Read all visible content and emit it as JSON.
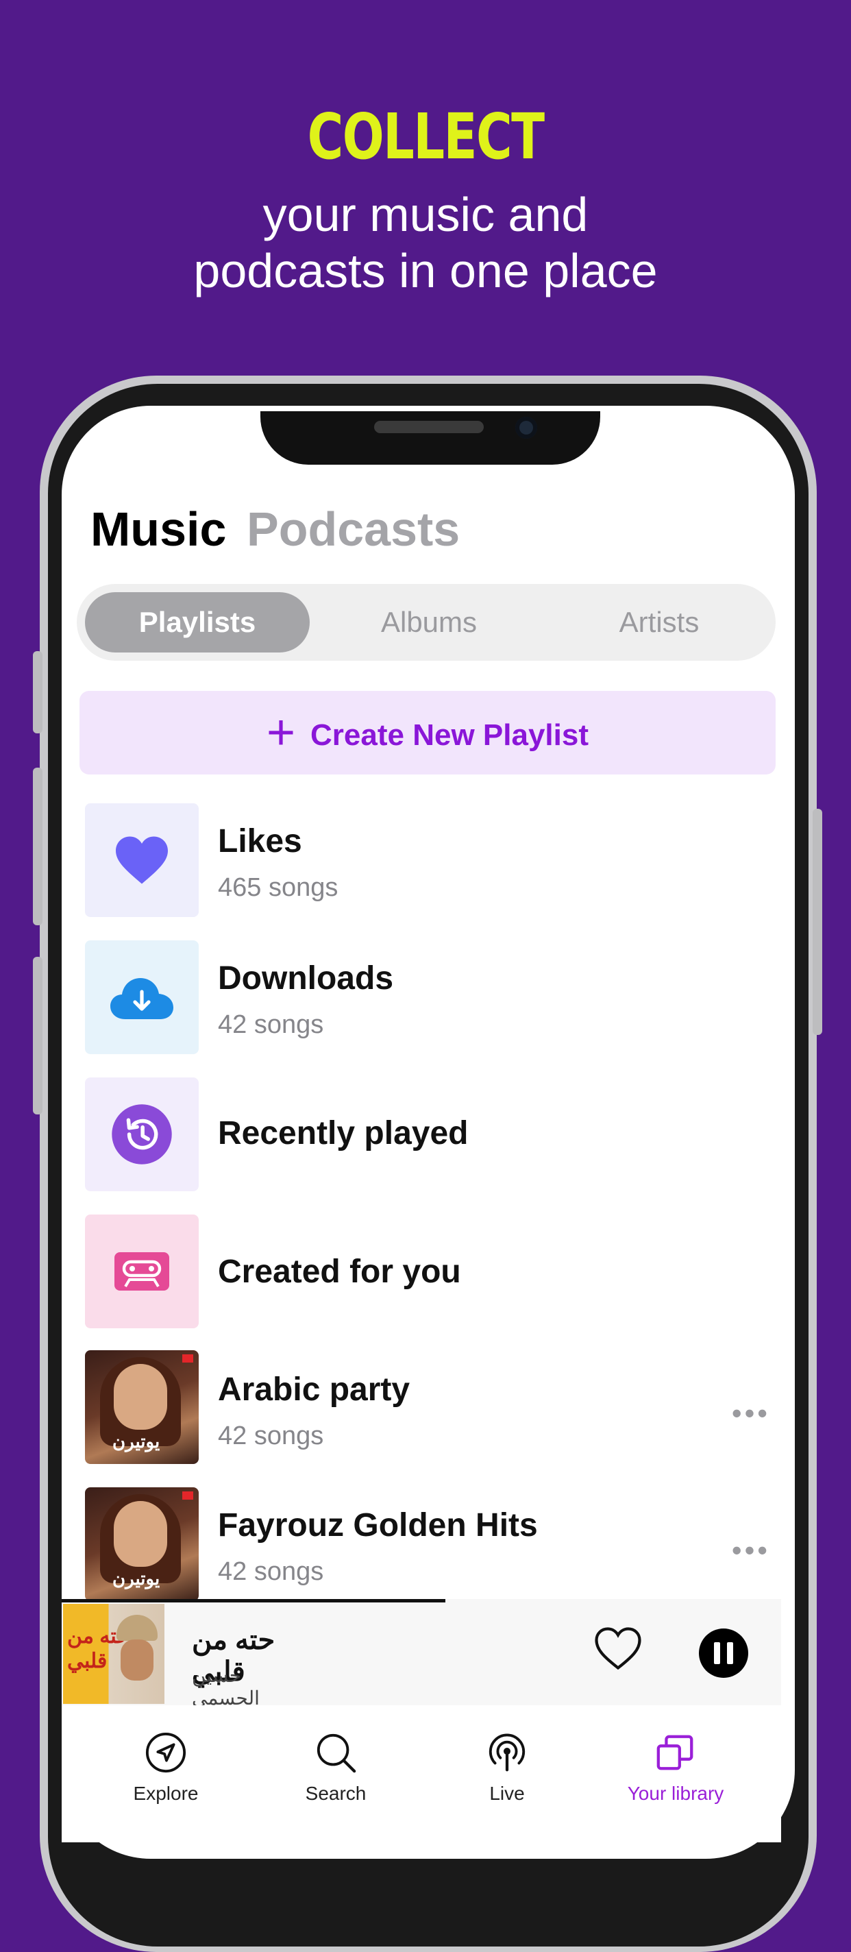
{
  "promo": {
    "headline": "COLLECT",
    "subline1": "your music and",
    "subline2": "podcasts in one place"
  },
  "colors": {
    "background": "#521a8a",
    "headline": "#dff21a",
    "accent": "#9a1fd8",
    "create_bg": "#f2e5fc"
  },
  "library": {
    "segments": {
      "music": "Music",
      "podcasts": "Podcasts"
    },
    "tabs": [
      {
        "label": "Playlists",
        "active": true
      },
      {
        "label": "Albums",
        "active": false
      },
      {
        "label": "Artists",
        "active": false
      }
    ],
    "create_label": "Create New Playlist",
    "items": [
      {
        "title": "Likes",
        "subtitle": "465 songs",
        "icon": "heart-icon"
      },
      {
        "title": "Downloads",
        "subtitle": "42 songs",
        "icon": "cloud-download-icon"
      },
      {
        "title": "Recently played",
        "subtitle": "",
        "icon": "history-icon"
      },
      {
        "title": "Created for you",
        "subtitle": "",
        "icon": "cassette-icon"
      },
      {
        "title": "Arabic party",
        "subtitle": "42 songs",
        "icon": "album-art"
      },
      {
        "title": "Fayrouz Golden Hits",
        "subtitle": "42 songs",
        "icon": "album-art"
      }
    ],
    "more_label": "•••",
    "album_art_text": "يوتيرن"
  },
  "player": {
    "title": "حته من قلبي",
    "artist": "حسين الجسمي",
    "art_text": "حته من قلبي"
  },
  "nav": [
    {
      "label": "Explore",
      "icon": "compass-icon",
      "active": false
    },
    {
      "label": "Search",
      "icon": "search-icon",
      "active": false
    },
    {
      "label": "Live",
      "icon": "broadcast-icon",
      "active": false
    },
    {
      "label": "Your library",
      "icon": "library-icon",
      "active": true
    }
  ]
}
